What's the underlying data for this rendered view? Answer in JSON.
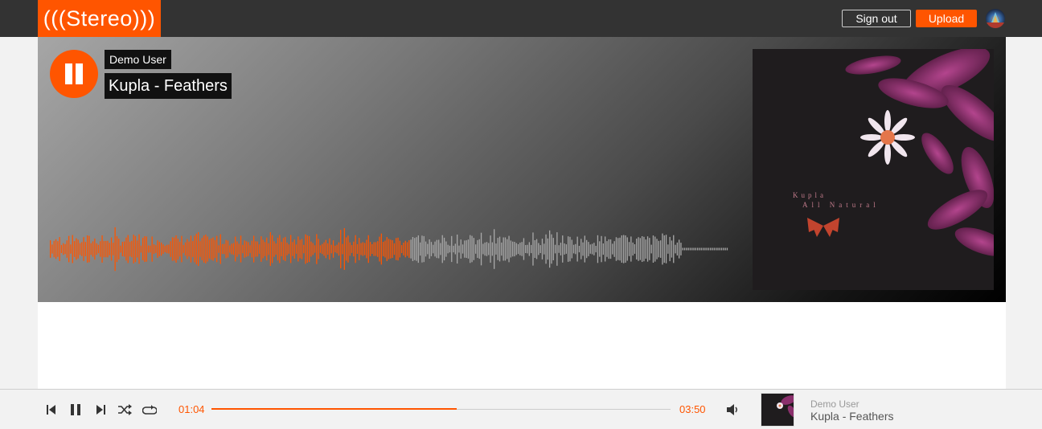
{
  "header": {
    "logo_text": "(((Stereo)))",
    "signout_label": "Sign out",
    "upload_label": "Upload",
    "avatar_icon": "user-avatar-icon"
  },
  "hero": {
    "user": "Demo User",
    "title": "Kupla - Feathers",
    "artwork_text": {
      "artist": "Kupla",
      "album": "All Natural"
    },
    "play_state_icon": "pause-icon",
    "waveform_progress": 0.53
  },
  "player": {
    "current_time": "01:04",
    "duration": "03:50",
    "progress": 0.535,
    "controls": [
      "previous-icon",
      "pause-icon",
      "next-icon",
      "shuffle-icon",
      "repeat-icon"
    ],
    "volume_icon": "volume-icon",
    "now_playing_user": "Demo User",
    "now_playing_title": "Kupla - Feathers"
  },
  "colors": {
    "accent": "#ff5500",
    "topbar": "#333333",
    "waveform_unplayed": "#a9a9a9"
  }
}
